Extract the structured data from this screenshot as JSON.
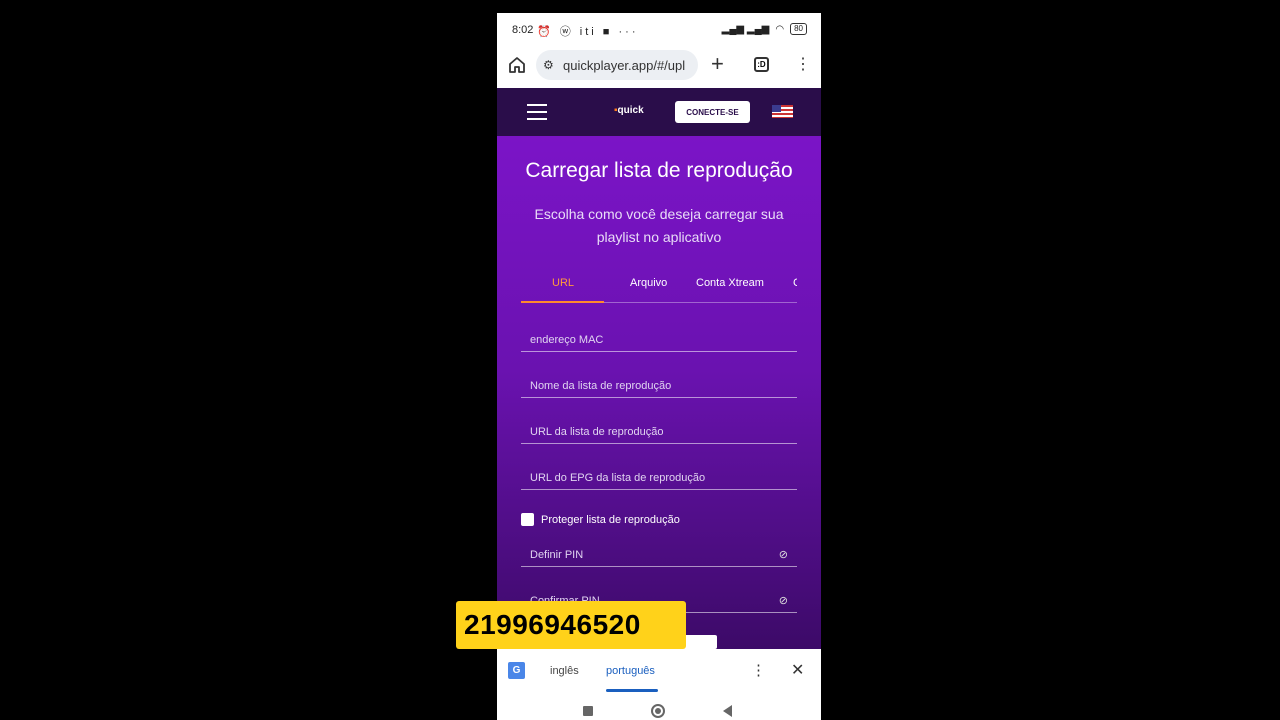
{
  "status_bar": {
    "time": "8:02",
    "left_icons": "⏰ ⓦ iti ■ ···",
    "right_icons": "▂▄▆ ▂▄▆",
    "battery": "80"
  },
  "browser": {
    "url": "quickplayer.app/#/upl",
    "tab_count": ":D"
  },
  "site_header": {
    "logo_prefix": "▪",
    "logo": "quick",
    "connect_label": "CONECTE-SE"
  },
  "page": {
    "title": "Carregar lista de reprodução",
    "subtitle": "Escolha como você deseja carregar sua playlist no aplicativo",
    "tabs": [
      {
        "label": "URL",
        "active": true
      },
      {
        "label": "Arquivo",
        "active": false
      },
      {
        "label": "Conta Xtream",
        "active": false
      },
      {
        "label": "C",
        "active": false
      }
    ],
    "fields": {
      "mac": "endereço MAC",
      "playlist_name": "Nome da lista de reprodução",
      "playlist_url": "URL da lista de reprodução",
      "epg_url": "URL do EPG da lista de reprodução",
      "pin": "Definir PIN",
      "confirm_pin": "Confirmar PIN"
    },
    "protect_label": "Proteger lista de reprodução"
  },
  "translate_bar": {
    "lang_from": "inglês",
    "lang_to": "português"
  },
  "overlay": {
    "phone_number": "21996946520"
  },
  "colors": {
    "accent": "#ff8a2d",
    "header_bg": "#2a0d4a",
    "content_bg": "#7b14c7",
    "overlay_bg": "#ffd21a"
  }
}
